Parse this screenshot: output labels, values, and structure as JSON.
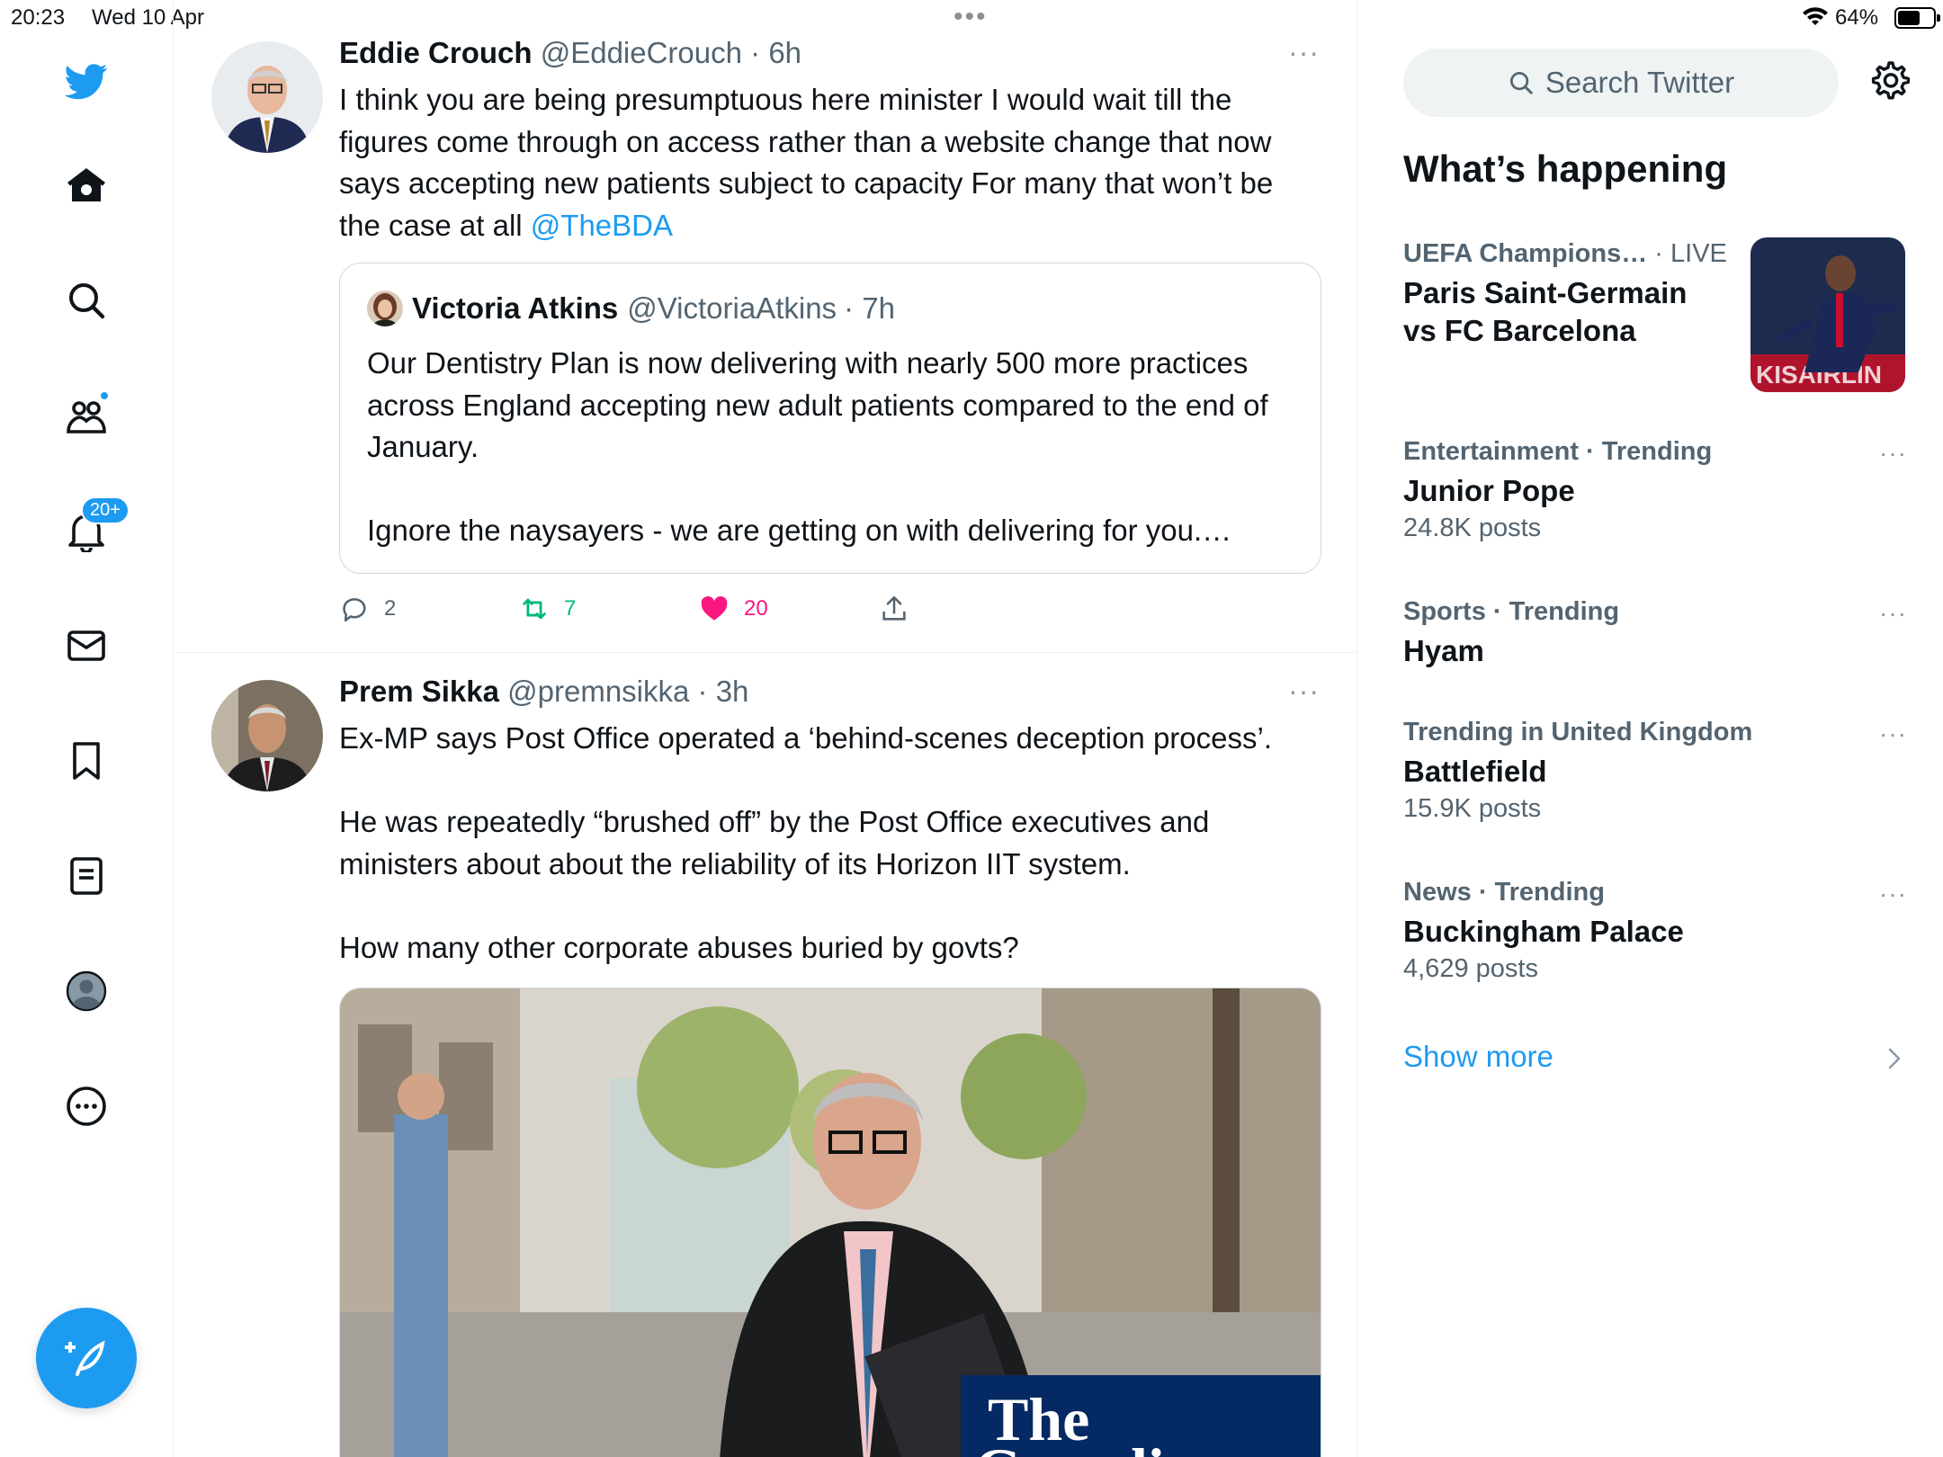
{
  "status_bar": {
    "time": "20:23",
    "date": "Wed 10 Apr",
    "battery_text": "64%",
    "battery_level": 0.64,
    "grabber": "•••"
  },
  "nav": {
    "notifications_badge": "20+",
    "icons": [
      "twitter-logo",
      "home-icon",
      "search-icon",
      "communities-icon",
      "notifications-icon",
      "messages-icon",
      "bookmarks-icon",
      "lists-icon",
      "profile-icon",
      "more-icon"
    ]
  },
  "tweets": [
    {
      "name": "Eddie Crouch",
      "handle": "@EddieCrouch",
      "time": "· 6h",
      "more": "···",
      "text_1": "I think you are being presumptuous here minister I would wait till the figures come through on access rather than a website change that now says accepting new patients subject to capacity For many that won’t be the case at all ",
      "mention": "@TheBDA",
      "quote": {
        "name": "Victoria Atkins",
        "handle": "@VictoriaAtkins",
        "time": "· 7h",
        "text_1": "Our Dentistry Plan is now delivering with nearly 500 more practices across England accepting new adult patients compared to the end of January.",
        "text_2": "Ignore the naysayers - we are getting on with delivering for you.…"
      },
      "replies": "2",
      "retweets": "7",
      "likes": "20"
    },
    {
      "name": "Prem Sikka",
      "handle": "@premnsikka",
      "time": "· 3h",
      "more": "···",
      "text_1": "Ex-MP says Post Office operated a ‘behind-scenes deception process’.",
      "text_2": "He was repeatedly “brushed off” by the Post Office executives and ministers about about the reliability of its Horizon IIT system.",
      "text_3": "How many other corporate abuses buried by govts?",
      "media_brand_line1": "The",
      "media_brand_line2": "Guardian"
    }
  ],
  "sidebar": {
    "search_placeholder": "Search Twitter",
    "whats_happening": "What’s happening",
    "trends": [
      {
        "category": "UEFA Champions…",
        "suffix": " · LIVE",
        "title_1": "Paris Saint-Germain",
        "title_2": "vs FC Barcelona"
      },
      {
        "category": "Entertainment · Trending",
        "title": "Junior Pope",
        "count": "24.8K posts"
      },
      {
        "category": "Sports · Trending",
        "title": "Hyam",
        "count": ""
      },
      {
        "category": "Trending in United Kingdom",
        "title": "Battlefield",
        "count": "15.9K posts"
      },
      {
        "category": "News · Trending",
        "title": "Buckingham Palace",
        "count": "4,629 posts"
      }
    ],
    "trend_more": "···",
    "show_more": "Show more"
  },
  "colors": {
    "accent": "#1d9bf0",
    "like": "#f91880",
    "retweet": "#00ba7c",
    "secondary_text": "#536471"
  }
}
